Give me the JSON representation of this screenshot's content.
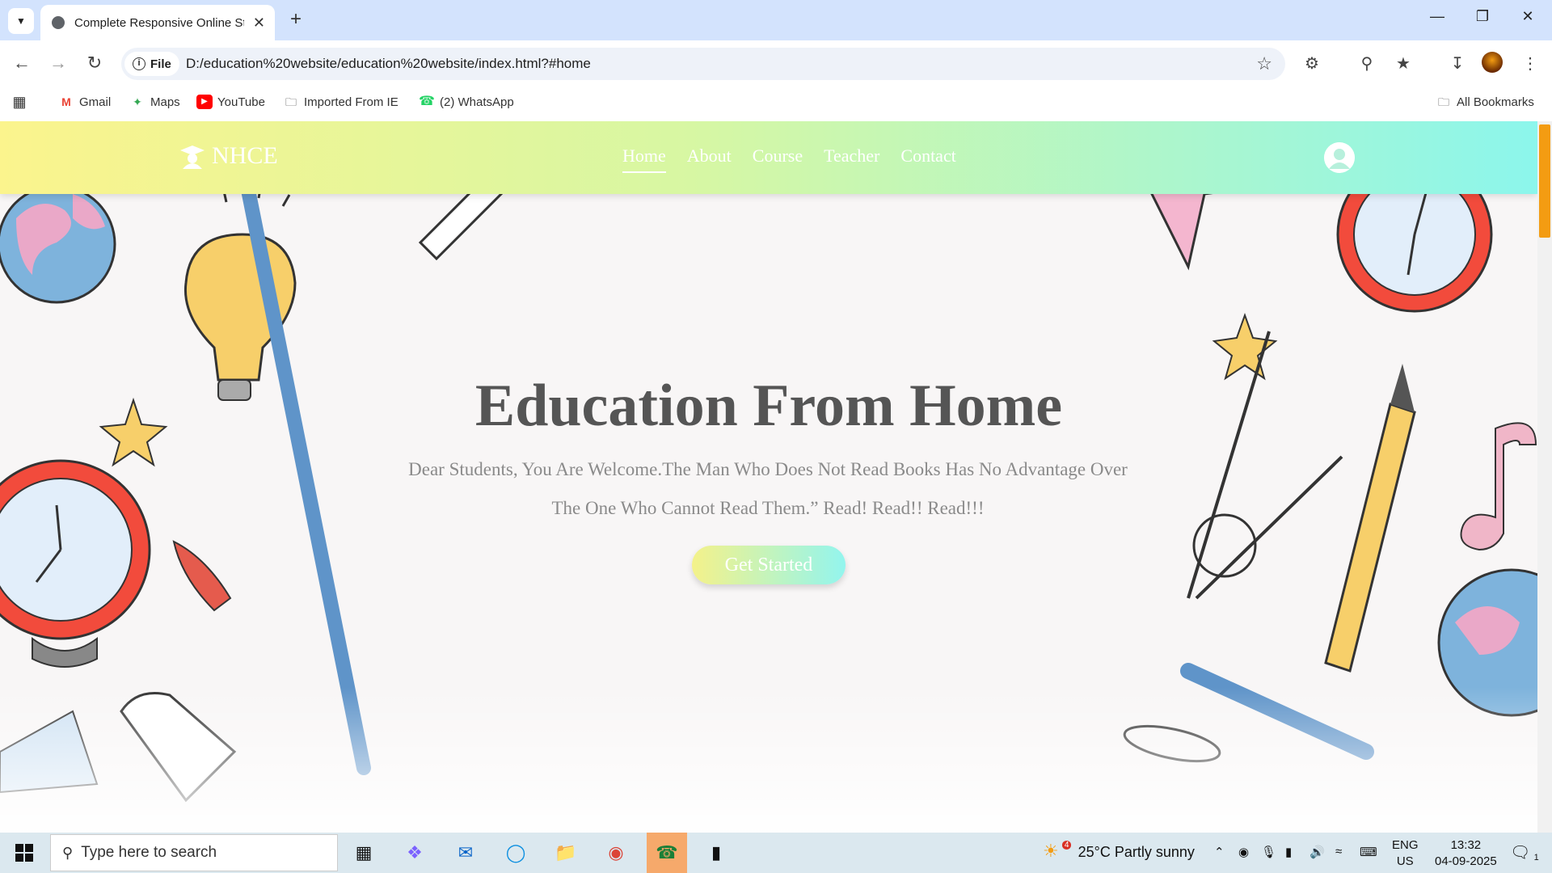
{
  "browser": {
    "tab_title": "Complete Responsive Online St",
    "url_chip": "File",
    "url": "D:/education%20website/education%20website/index.html?#home"
  },
  "bookmarks": {
    "items": [
      {
        "label": "Gmail",
        "icon": "gmail-icon"
      },
      {
        "label": "Maps",
        "icon": "maps-icon"
      },
      {
        "label": "YouTube",
        "icon": "youtube-icon"
      },
      {
        "label": "Imported From IE",
        "icon": "folder-icon"
      },
      {
        "label": "(2) WhatsApp",
        "icon": "whatsapp-icon"
      }
    ],
    "all_bookmarks": "All Bookmarks"
  },
  "site": {
    "logo": "NHCE",
    "nav": [
      "Home",
      "About",
      "Course",
      "Teacher",
      "Contact"
    ],
    "active_nav": "Home",
    "hero_title": "Education From Home",
    "hero_text": "Dear Students, You Are Welcome.The Man Who Does Not Read Books Has No Advantage Over The One Who Cannot Read Them.” Read! Read!! Read!!!",
    "cta": "Get Started",
    "colors": {
      "header_left": "#fbf48d",
      "header_right": "#8cf6ec",
      "title": "#555555"
    }
  },
  "taskbar": {
    "search_placeholder": "Type here to search",
    "weather": "25°C  Partly sunny",
    "weather_badge": "4",
    "lang_line1": "ENG",
    "lang_line2": "US",
    "time": "13:32",
    "date": "04-09-2025",
    "notification_count": "1"
  }
}
